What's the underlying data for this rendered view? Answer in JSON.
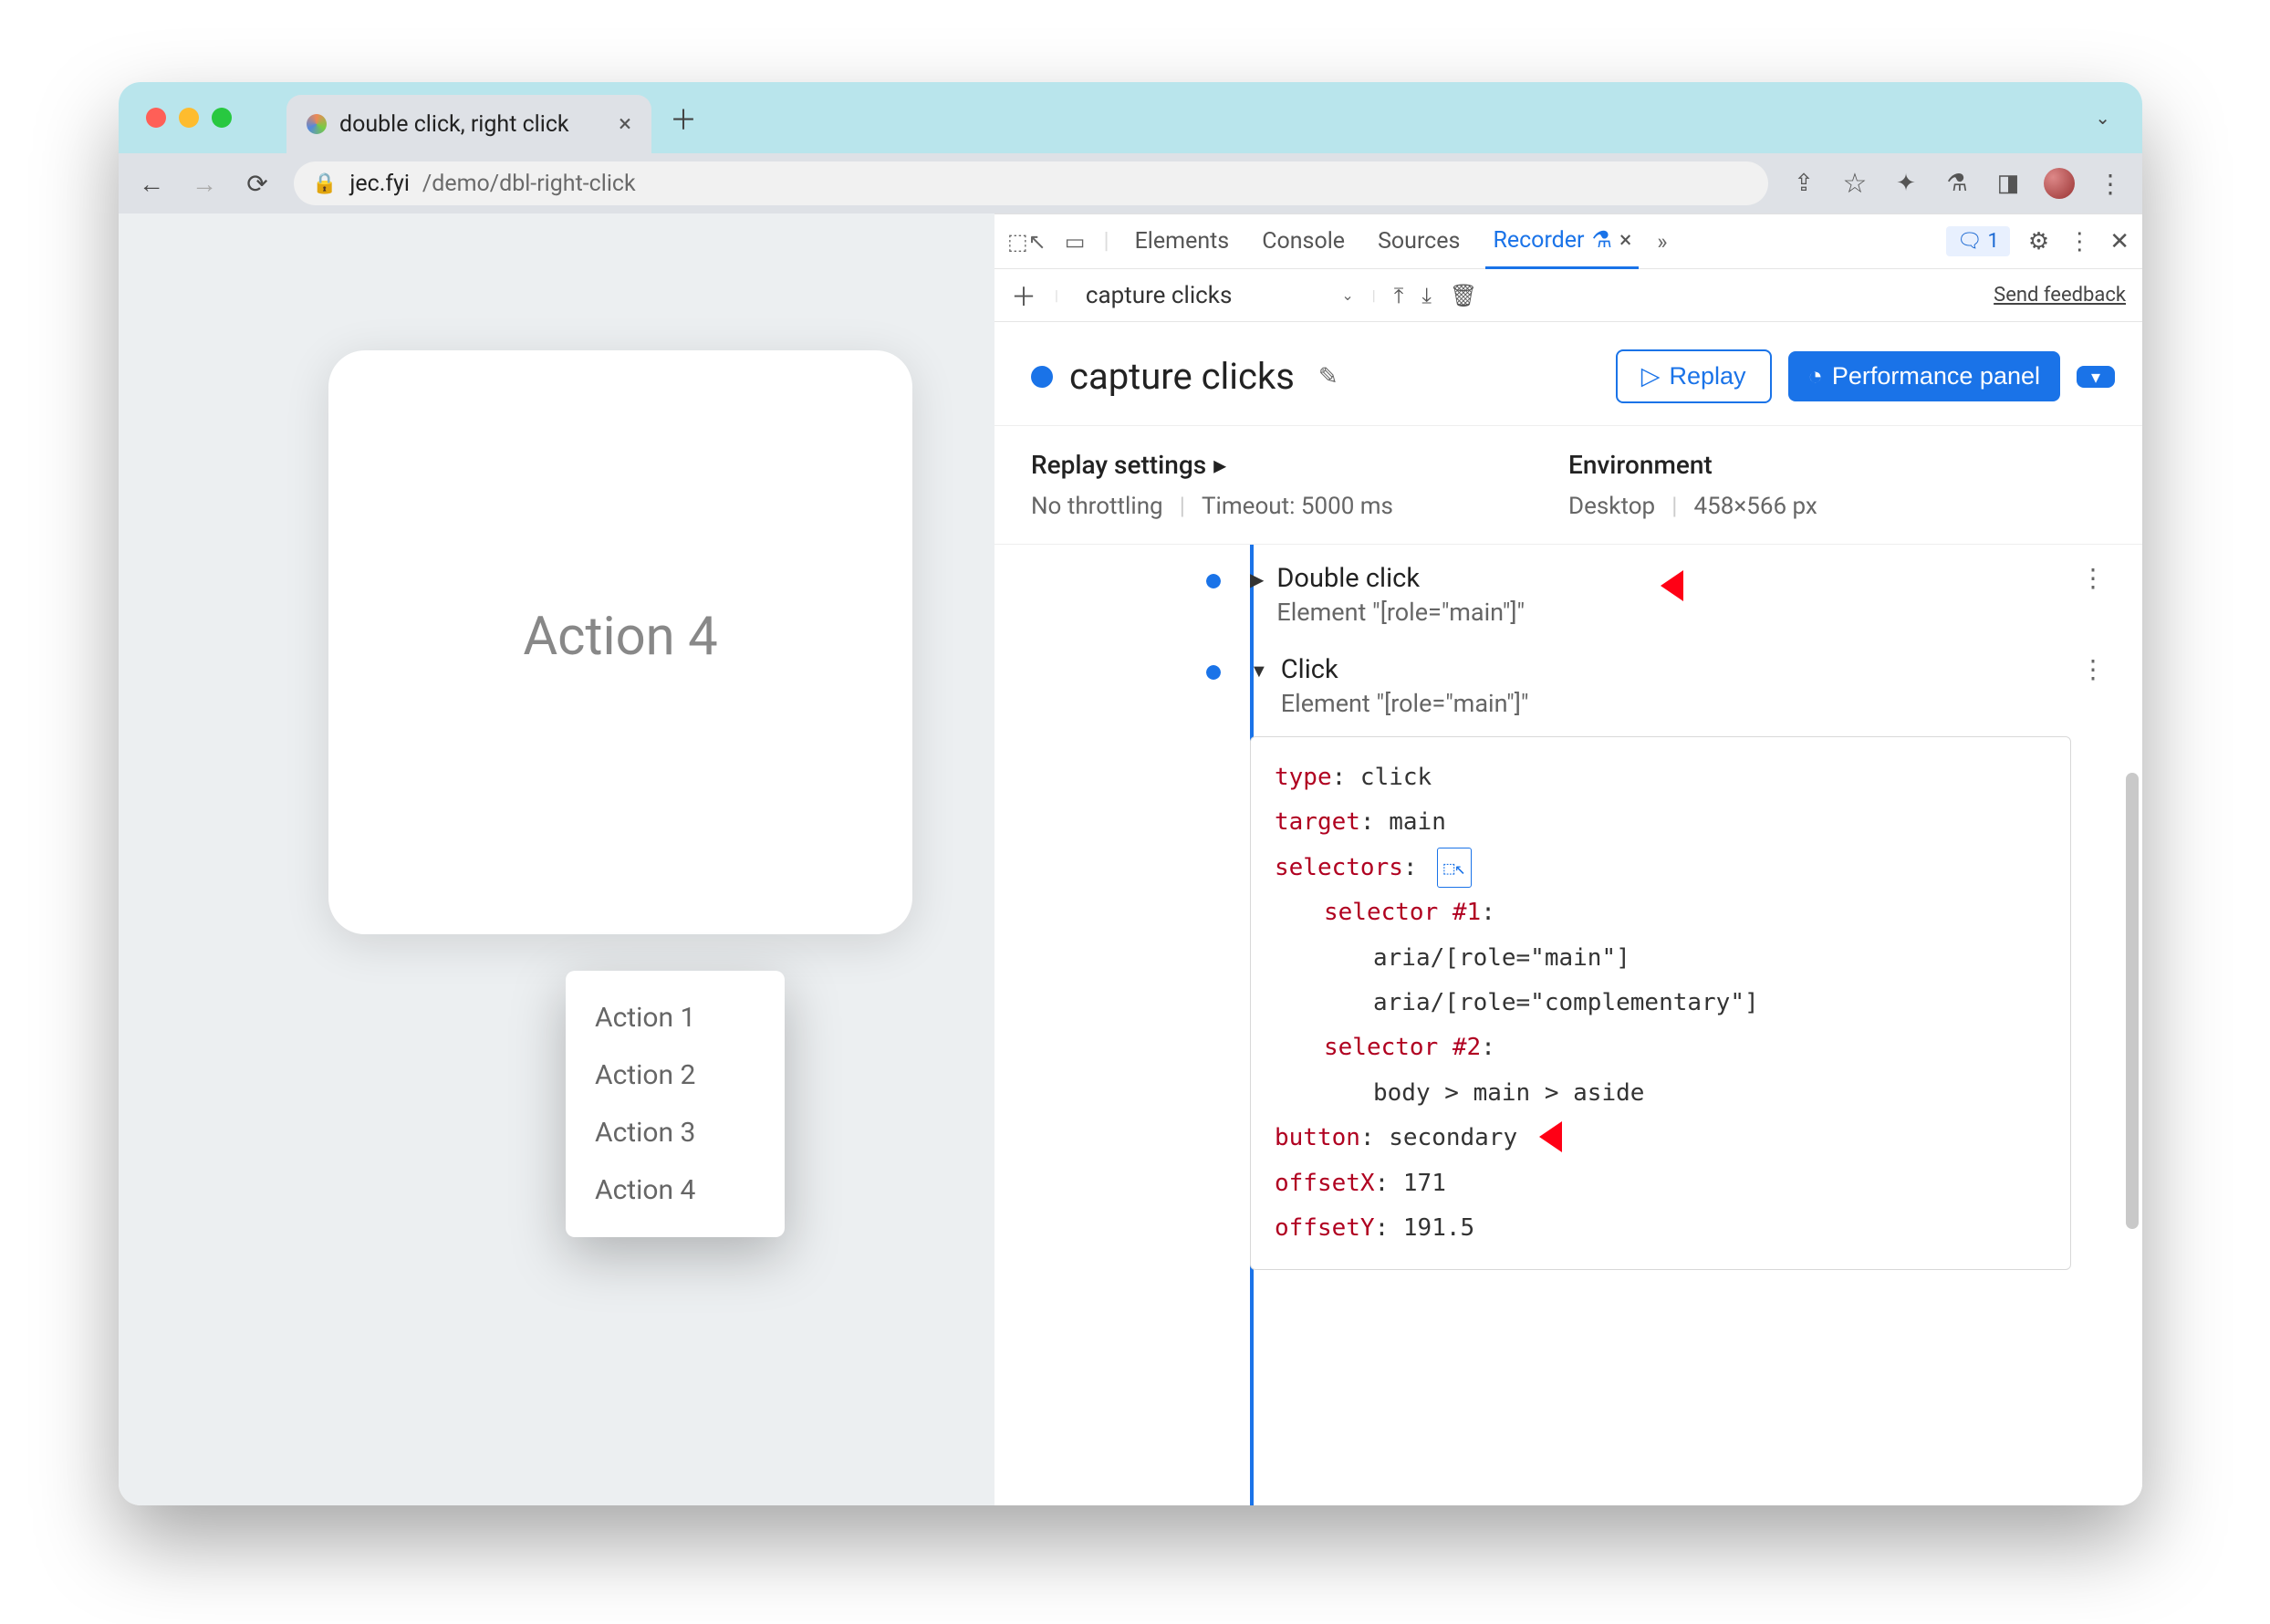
{
  "tab": {
    "title": "double click, right click"
  },
  "url": {
    "host": "jec.fyi",
    "path": "/demo/dbl-right-click"
  },
  "page": {
    "heading": "Action 4",
    "menu_items": [
      "Action 1",
      "Action 2",
      "Action 3",
      "Action 4"
    ]
  },
  "devtools": {
    "tabs": [
      "Elements",
      "Console",
      "Sources"
    ],
    "active_tab": "Recorder",
    "issues_count": "1",
    "subbar": {
      "recording": "capture clicks",
      "feedback": "Send feedback"
    },
    "rec": {
      "name": "capture clicks",
      "replay_btn": "Replay",
      "perf_btn": "Performance panel"
    },
    "settings": {
      "replay_hdr": "Replay settings",
      "throttling": "No throttling",
      "timeout": "Timeout: 5000 ms",
      "env_hdr": "Environment",
      "device": "Desktop",
      "size": "458×566 px"
    },
    "steps": [
      {
        "title": "Double click",
        "sub": "Element \"[role=\"main\"]\"",
        "expanded": false
      },
      {
        "title": "Click",
        "sub": "Element \"[role=\"main\"]\"",
        "expanded": true,
        "detail": {
          "type_k": "type",
          "type_v": ": click",
          "target_k": "target",
          "target_v": ": main",
          "selectors_k": "selectors",
          "selectors_v": ": ",
          "sel1_k": "selector #1",
          "sel1_v": ":",
          "sel1_a": "aria/[role=\"main\"]",
          "sel1_b": "aria/[role=\"complementary\"]",
          "sel2_k": "selector #2",
          "sel2_v": ":",
          "sel2_a": "body > main > aside",
          "button_k": "button",
          "button_v": ": secondary",
          "ox_k": "offsetX",
          "ox_v": ": 171",
          "oy_k": "offsetY",
          "oy_v": ": 191.5"
        }
      }
    ]
  }
}
